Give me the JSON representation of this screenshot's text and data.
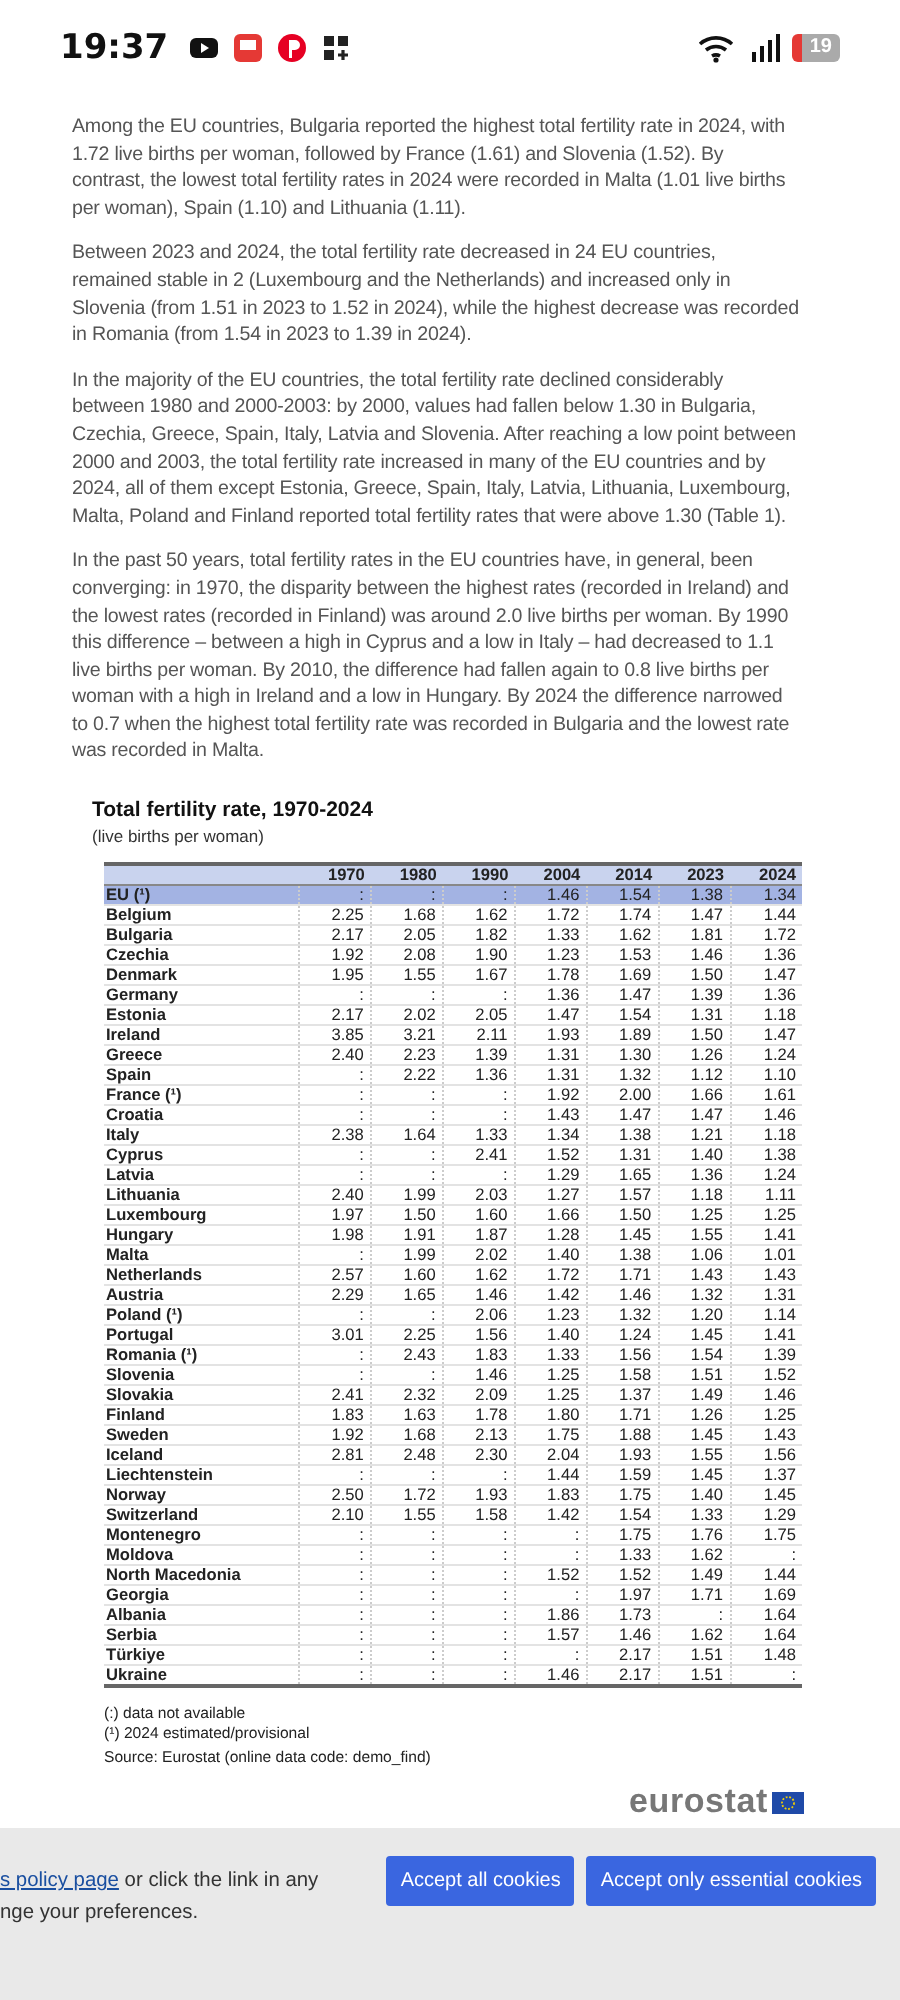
{
  "status_bar": {
    "time": "19:37",
    "battery": "19"
  },
  "article": {
    "paragraphs": [
      "Among the EU countries, Bulgaria reported the highest total fertility rate in 2024, with 1.72 live births per woman, followed by France (1.61) and Slovenia (1.52). By contrast, the lowest total fertility rates in 2024 were recorded in Malta (1.01 live births per woman), Spain (1.10) and Lithuania (1.11).",
      "Between 2023 and 2024, the total fertility rate decreased in 24 EU countries, remained stable in 2 (Luxembourg and the Netherlands) and increased only in Slovenia (from 1.51 in 2023 to 1.52 in 2024), while the highest decrease was recorded in Romania (from 1.54 in 2023 to 1.39 in 2024).",
      "In the majority of the EU countries, the total fertility rate declined considerably between 1980 and 2000-2003: by 2000, values had fallen below 1.30 in Bulgaria, Czechia, Greece, Spain, Italy, Latvia and Slovenia. After reaching a low point between 2000 and 2003, the total fertility rate increased in many of the EU countries and by 2024, all of them except Estonia, Greece, Spain, Italy, Latvia, Lithuania, Luxembourg, Malta, Poland and Finland reported total fertility rates that were above 1.30 (Table 1).",
      "In the past 50 years, total fertility rates in the EU countries have, in general, been converging: in 1970, the disparity between the highest rates (recorded in Ireland) and the lowest rates (recorded in Finland) was around 2.0 live births per woman. By 1990 this difference – between a high in Cyprus and a low in Italy – had decreased to 1.1 live births per woman. By 2010, the difference had fallen again to 0.8 live births per woman with a high in Ireland and a low in Hungary. By 2024 the difference narrowed to 0.7 when the highest total fertility rate was recorded in Bulgaria and the lowest rate was recorded in Malta."
    ]
  },
  "table": {
    "title": "Total fertility rate, 1970-2024",
    "subtitle": "(live births per woman)",
    "columns": [
      "1970",
      "1980",
      "1990",
      "2004",
      "2014",
      "2023",
      "2024"
    ],
    "groups": [
      [
        {
          "name": "EU (¹)",
          "highlighted": true,
          "values": [
            ":",
            ":",
            ":",
            "1.46",
            "1.54",
            "1.38",
            "1.34"
          ]
        },
        {
          "name": "Belgium",
          "highlighted": false,
          "values": [
            "2.25",
            "1.68",
            "1.62",
            "1.72",
            "1.74",
            "1.47",
            "1.44"
          ]
        },
        {
          "name": "Bulgaria",
          "highlighted": false,
          "values": [
            "2.17",
            "2.05",
            "1.82",
            "1.33",
            "1.62",
            "1.81",
            "1.72"
          ]
        },
        {
          "name": "Czechia",
          "highlighted": false,
          "values": [
            "1.92",
            "2.08",
            "1.90",
            "1.23",
            "1.53",
            "1.46",
            "1.36"
          ]
        },
        {
          "name": "Denmark",
          "highlighted": false,
          "values": [
            "1.95",
            "1.55",
            "1.67",
            "1.78",
            "1.69",
            "1.50",
            "1.47"
          ]
        },
        {
          "name": "Germany",
          "highlighted": false,
          "values": [
            ":",
            ":",
            ":",
            "1.36",
            "1.47",
            "1.39",
            "1.36"
          ]
        },
        {
          "name": "Estonia",
          "highlighted": false,
          "values": [
            "2.17",
            "2.02",
            "2.05",
            "1.47",
            "1.54",
            "1.31",
            "1.18"
          ]
        },
        {
          "name": "Ireland",
          "highlighted": false,
          "values": [
            "3.85",
            "3.21",
            "2.11",
            "1.93",
            "1.89",
            "1.50",
            "1.47"
          ]
        },
        {
          "name": "Greece",
          "highlighted": false,
          "values": [
            "2.40",
            "2.23",
            "1.39",
            "1.31",
            "1.30",
            "1.26",
            "1.24"
          ]
        },
        {
          "name": "Spain",
          "highlighted": false,
          "values": [
            ":",
            "2.22",
            "1.36",
            "1.31",
            "1.32",
            "1.12",
            "1.10"
          ]
        },
        {
          "name": "France (¹)",
          "highlighted": false,
          "values": [
            ":",
            ":",
            ":",
            "1.92",
            "2.00",
            "1.66",
            "1.61"
          ]
        },
        {
          "name": "Croatia",
          "highlighted": false,
          "values": [
            ":",
            ":",
            ":",
            "1.43",
            "1.47",
            "1.47",
            "1.46"
          ]
        },
        {
          "name": "Italy",
          "highlighted": false,
          "values": [
            "2.38",
            "1.64",
            "1.33",
            "1.34",
            "1.38",
            "1.21",
            "1.18"
          ]
        },
        {
          "name": "Cyprus",
          "highlighted": false,
          "values": [
            ":",
            ":",
            "2.41",
            "1.52",
            "1.31",
            "1.40",
            "1.38"
          ]
        },
        {
          "name": "Latvia",
          "highlighted": false,
          "values": [
            ":",
            ":",
            ":",
            "1.29",
            "1.65",
            "1.36",
            "1.24"
          ]
        },
        {
          "name": "Lithuania",
          "highlighted": false,
          "values": [
            "2.40",
            "1.99",
            "2.03",
            "1.27",
            "1.57",
            "1.18",
            "1.11"
          ]
        },
        {
          "name": "Luxembourg",
          "highlighted": false,
          "values": [
            "1.97",
            "1.50",
            "1.60",
            "1.66",
            "1.50",
            "1.25",
            "1.25"
          ]
        },
        {
          "name": "Hungary",
          "highlighted": false,
          "values": [
            "1.98",
            "1.91",
            "1.87",
            "1.28",
            "1.45",
            "1.55",
            "1.41"
          ]
        },
        {
          "name": "Malta",
          "highlighted": false,
          "values": [
            ":",
            "1.99",
            "2.02",
            "1.40",
            "1.38",
            "1.06",
            "1.01"
          ]
        },
        {
          "name": "Netherlands",
          "highlighted": false,
          "values": [
            "2.57",
            "1.60",
            "1.62",
            "1.72",
            "1.71",
            "1.43",
            "1.43"
          ]
        },
        {
          "name": "Austria",
          "highlighted": false,
          "values": [
            "2.29",
            "1.65",
            "1.46",
            "1.42",
            "1.46",
            "1.32",
            "1.31"
          ]
        },
        {
          "name": "Poland (¹)",
          "highlighted": false,
          "values": [
            ":",
            ":",
            "2.06",
            "1.23",
            "1.32",
            "1.20",
            "1.14"
          ]
        },
        {
          "name": "Portugal",
          "highlighted": false,
          "values": [
            "3.01",
            "2.25",
            "1.56",
            "1.40",
            "1.24",
            "1.45",
            "1.41"
          ]
        },
        {
          "name": "Romania (¹)",
          "highlighted": false,
          "values": [
            ":",
            "2.43",
            "1.83",
            "1.33",
            "1.56",
            "1.54",
            "1.39"
          ]
        },
        {
          "name": "Slovenia",
          "highlighted": false,
          "values": [
            ":",
            ":",
            "1.46",
            "1.25",
            "1.58",
            "1.51",
            "1.52"
          ]
        },
        {
          "name": "Slovakia",
          "highlighted": false,
          "values": [
            "2.41",
            "2.32",
            "2.09",
            "1.25",
            "1.37",
            "1.49",
            "1.46"
          ]
        },
        {
          "name": "Finland",
          "highlighted": false,
          "values": [
            "1.83",
            "1.63",
            "1.78",
            "1.80",
            "1.71",
            "1.26",
            "1.25"
          ]
        },
        {
          "name": "Sweden",
          "highlighted": false,
          "values": [
            "1.92",
            "1.68",
            "2.13",
            "1.75",
            "1.88",
            "1.45",
            "1.43"
          ]
        }
      ],
      [
        {
          "name": "Iceland",
          "highlighted": false,
          "values": [
            "2.81",
            "2.48",
            "2.30",
            "2.04",
            "1.93",
            "1.55",
            "1.56"
          ]
        },
        {
          "name": "Liechtenstein",
          "highlighted": false,
          "values": [
            ":",
            ":",
            ":",
            "1.44",
            "1.59",
            "1.45",
            "1.37"
          ]
        },
        {
          "name": "Norway",
          "highlighted": false,
          "values": [
            "2.50",
            "1.72",
            "1.93",
            "1.83",
            "1.75",
            "1.40",
            "1.45"
          ]
        },
        {
          "name": "Switzerland",
          "highlighted": false,
          "values": [
            "2.10",
            "1.55",
            "1.58",
            "1.42",
            "1.54",
            "1.33",
            "1.29"
          ]
        }
      ],
      [
        {
          "name": "Montenegro",
          "highlighted": false,
          "values": [
            ":",
            ":",
            ":",
            ":",
            "1.75",
            "1.76",
            "1.75"
          ]
        },
        {
          "name": "Moldova",
          "highlighted": false,
          "values": [
            ":",
            ":",
            ":",
            ":",
            "1.33",
            "1.62",
            ":"
          ]
        },
        {
          "name": "North Macedonia",
          "highlighted": false,
          "values": [
            ":",
            ":",
            ":",
            "1.52",
            "1.52",
            "1.49",
            "1.44"
          ]
        },
        {
          "name": "Georgia",
          "highlighted": false,
          "values": [
            ":",
            ":",
            ":",
            ":",
            "1.97",
            "1.71",
            "1.69"
          ]
        },
        {
          "name": "Albania",
          "highlighted": false,
          "values": [
            ":",
            ":",
            ":",
            "1.86",
            "1.73",
            ":",
            "1.64"
          ]
        },
        {
          "name": "Serbia",
          "highlighted": false,
          "values": [
            ":",
            ":",
            ":",
            "1.57",
            "1.46",
            "1.62",
            "1.64"
          ]
        },
        {
          "name": "Türkiye",
          "highlighted": false,
          "values": [
            ":",
            ":",
            ":",
            ":",
            "2.17",
            "1.51",
            "1.48"
          ]
        },
        {
          "name": "Ukraine",
          "highlighted": false,
          "values": [
            ":",
            ":",
            ":",
            "1.46",
            "2.17",
            "1.51",
            ":"
          ]
        }
      ]
    ],
    "notes": [
      "(:) data not available",
      "(¹) 2024 estimated/provisional"
    ],
    "source": "Source: Eurostat (online data code: demo_find)",
    "logo": "eurostat"
  },
  "cookie_banner": {
    "link": "s policy page",
    "line_1": " or click the link in any",
    "line_2": "nge your preferences.",
    "buttons": [
      "Accept all cookies",
      "Accept only essential cookies"
    ]
  }
}
